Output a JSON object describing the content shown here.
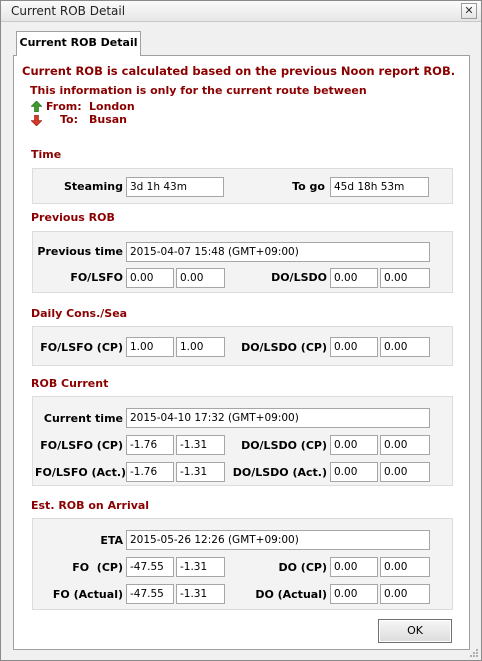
{
  "window": {
    "title": "Current ROB Detail",
    "close_glyph": "✕"
  },
  "tab": {
    "label": "Current ROB Detail"
  },
  "info": {
    "line1": "Current ROB is calculated based on the previous Noon report ROB.",
    "line2": "This information is only for the current route between",
    "from_label": "From:",
    "from_value": "London",
    "to_label": "To:",
    "to_value": "Busan",
    "from_icon": "green-up-arrow-icon",
    "to_icon": "red-down-arrow-icon"
  },
  "time": {
    "title": "Time",
    "steaming_label": "Steaming",
    "steaming_value": "3d 1h 43m",
    "togo_label": "To go",
    "togo_value": "45d 18h 53m"
  },
  "previous_rob": {
    "title": "Previous ROB",
    "time_label": "Previous time",
    "time_value": "2015-04-07 15:48 (GMT+09:00)",
    "fo_label": "FO/LSFO",
    "fo_value": "0.00",
    "lsfo_value": "0.00",
    "do_label": "DO/LSDO",
    "do_value": "0.00",
    "lsdo_value": "0.00"
  },
  "daily_cons": {
    "title": "Daily Cons./Sea",
    "fo_label": "FO/LSFO (CP)",
    "fo_value": "1.00",
    "lsfo_value": "1.00",
    "do_label": "DO/LSDO (CP)",
    "do_value": "0.00",
    "lsdo_value": "0.00"
  },
  "rob_current": {
    "title": "ROB Current",
    "time_label": "Current time",
    "time_value": "2015-04-10 17:32 (GMT+09:00)",
    "fo_cp_label": "FO/LSFO (CP)",
    "fo_cp_value": "-1.76",
    "lsfo_cp_value": "-1.31",
    "do_cp_label": "DO/LSDO (CP)",
    "do_cp_value": "0.00",
    "lsdo_cp_value": "0.00",
    "fo_act_label": "FO/LSFO (Act.)",
    "fo_act_value": "-1.76",
    "lsfo_act_value": "-1.31",
    "do_act_label": "DO/LSDO (Act.)",
    "do_act_value": "0.00",
    "lsdo_act_value": "0.00"
  },
  "arrival": {
    "title": "Est. ROB on Arrival",
    "eta_label": "ETA",
    "eta_value": "2015-05-26 12:26 (GMT+09:00)",
    "fo_cp_label": "FO  (CP)",
    "fo_cp_value": "-47.55",
    "lsfo_cp_value": "-1.31",
    "do_cp_label": "DO (CP)",
    "do_cp_value": "0.00",
    "lsdo_cp_value": "0.00",
    "fo_act_label": "FO (Actual)",
    "fo_act_value": "-47.55",
    "lsfo_act_value": "-1.31",
    "do_act_label": "DO (Actual)",
    "do_act_value": "0.00",
    "lsdo_act_value": "0.00"
  },
  "buttons": {
    "ok_label": "OK"
  },
  "colors": {
    "section_title": "#8b0000",
    "group_bg": "#f3f3f3"
  }
}
